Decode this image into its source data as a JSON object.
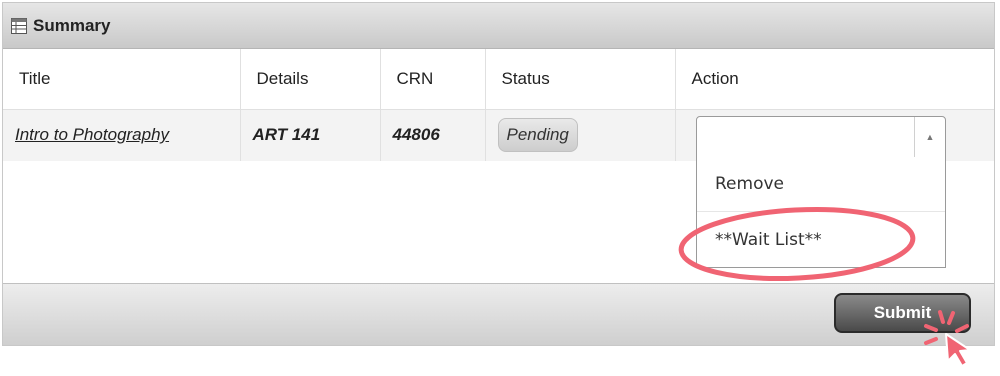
{
  "panel": {
    "title": "Summary",
    "icon": "table-icon"
  },
  "table": {
    "columns": [
      "Title",
      "Details",
      "CRN",
      "Status",
      "Action"
    ],
    "rows": [
      {
        "title": "Intro to Photography",
        "details": "ART 141",
        "crn": "44806",
        "status": "Pending",
        "action_value": ""
      }
    ]
  },
  "dropdown": {
    "options": [
      "Remove",
      "**Wait List**"
    ],
    "highlighted_option": "**Wait List**",
    "arrow_icon": "caret-up-icon"
  },
  "footer": {
    "submit_label": "Submit"
  },
  "annotations": {
    "highlight_color": "#f06473",
    "cursor_icon": "click-cursor-icon"
  }
}
